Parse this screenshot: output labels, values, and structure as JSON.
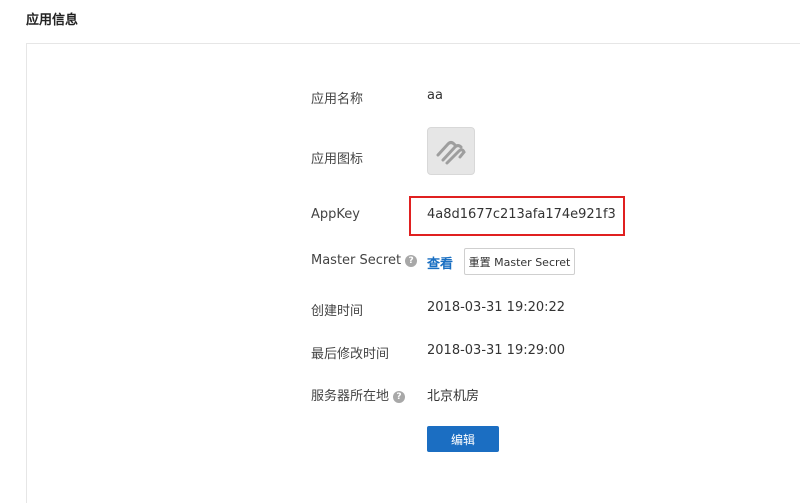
{
  "page": {
    "title": "应用信息"
  },
  "app_info": {
    "name_label": "应用名称",
    "name_value": "aa",
    "icon_label": "应用图标",
    "appkey_label": "AppKey",
    "appkey_value": "4a8d1677c213afa174e921f3",
    "master_secret_label": "Master Secret",
    "master_secret_view": "查看",
    "master_secret_reset": "重置 Master Secret",
    "created_label": "创建时间",
    "created_value": "2018-03-31 19:20:22",
    "modified_label": "最后修改时间",
    "modified_value": "2018-03-31 19:29:00",
    "server_label": "服务器所在地",
    "server_value": "北京机房",
    "help_glyph": "?",
    "edit_button": "编辑"
  },
  "colors": {
    "primary": "#1b6ec2",
    "link": "#1a6fc2",
    "highlight": "#e02020"
  },
  "icons": {
    "app_icon": "app-placeholder-icon",
    "help": "question-mark-icon"
  }
}
